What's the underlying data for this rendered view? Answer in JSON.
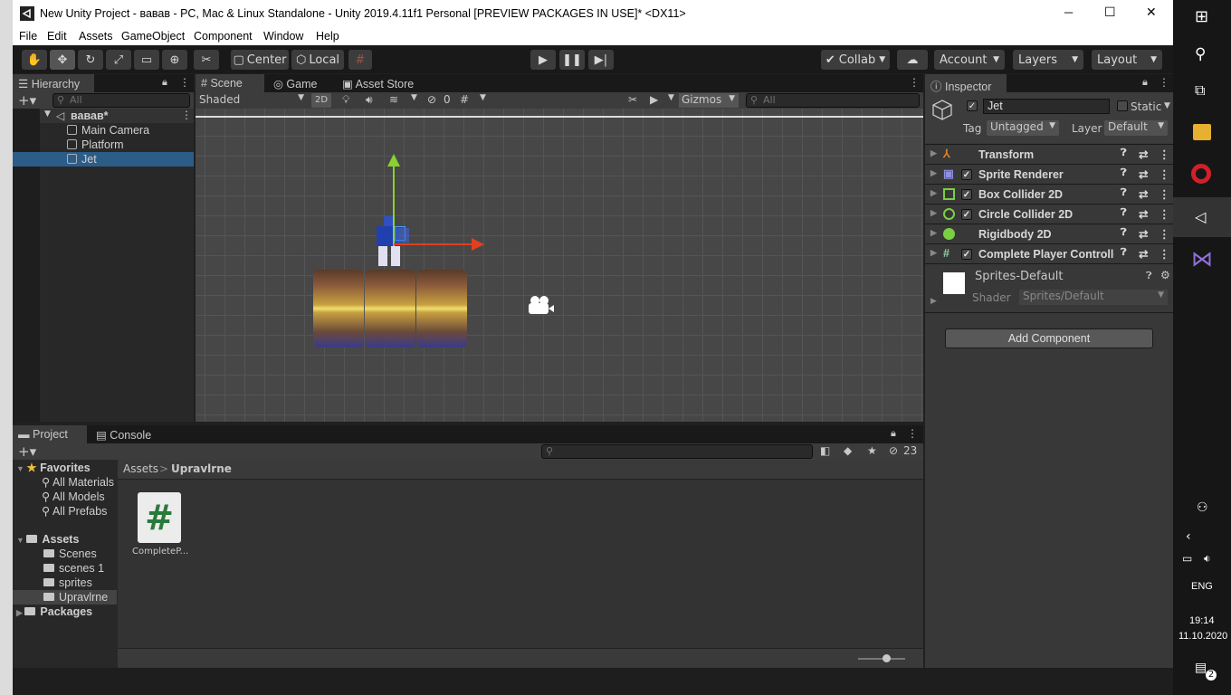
{
  "window": {
    "title": "New Unity Project - вавав - PC, Mac & Linux Standalone - Unity 2019.4.11f1 Personal [PREVIEW PACKAGES IN USE]* <DX11>",
    "minimize": "─",
    "maximize": "☐",
    "close": "✕"
  },
  "menu": [
    "File",
    "Edit",
    "Assets",
    "GameObject",
    "Component",
    "Window",
    "Help"
  ],
  "toolbar": {
    "pivot": "Center",
    "space": "Local",
    "collab": "Collab",
    "account": "Account",
    "layers": "Layers",
    "layout": "Layout"
  },
  "hierarchy": {
    "tab": "Hierarchy",
    "search_placeholder": "All",
    "scene": "вавав*",
    "items": [
      "Main Camera",
      "Platform",
      "Jet"
    ]
  },
  "scene_tabs": {
    "scene": "Scene",
    "game": "Game",
    "store": "Asset Store"
  },
  "scene_bar": {
    "shading": "Shaded",
    "mode2d": "2D",
    "hidden_count": "0",
    "gizmos": "Gizmos",
    "search_placeholder": "All"
  },
  "inspector": {
    "tab": "Inspector",
    "object_name": "Jet",
    "static_label": "Static",
    "tag_label": "Tag",
    "tag_value": "Untagged",
    "layer_label": "Layer",
    "layer_value": "Default",
    "components": [
      "Transform",
      "Sprite Renderer",
      "Box Collider 2D",
      "Circle Collider 2D",
      "Rigidbody 2D",
      "Complete Player Controlle"
    ],
    "material_name": "Sprites-Default",
    "shader_label": "Shader",
    "shader_value": "Sprites/Default",
    "add_component": "Add Component"
  },
  "project": {
    "tab_project": "Project",
    "tab_console": "Console",
    "favorites": "Favorites",
    "fav_items": [
      "All Materials",
      "All Models",
      "All Prefabs"
    ],
    "assets": "Assets",
    "asset_folders": [
      "Scenes",
      "scenes 1",
      "sprites",
      "Upravlrne"
    ],
    "packages": "Packages",
    "breadcrumb_root": "Assets",
    "breadcrumb_sep": ">",
    "breadcrumb_current": "Upravlrne",
    "file_name": "CompleteP...",
    "hidden_count": "23"
  },
  "taskbar": {
    "lang": "ENG",
    "time": "19:14",
    "date": "11.10.2020",
    "notif": "2"
  }
}
